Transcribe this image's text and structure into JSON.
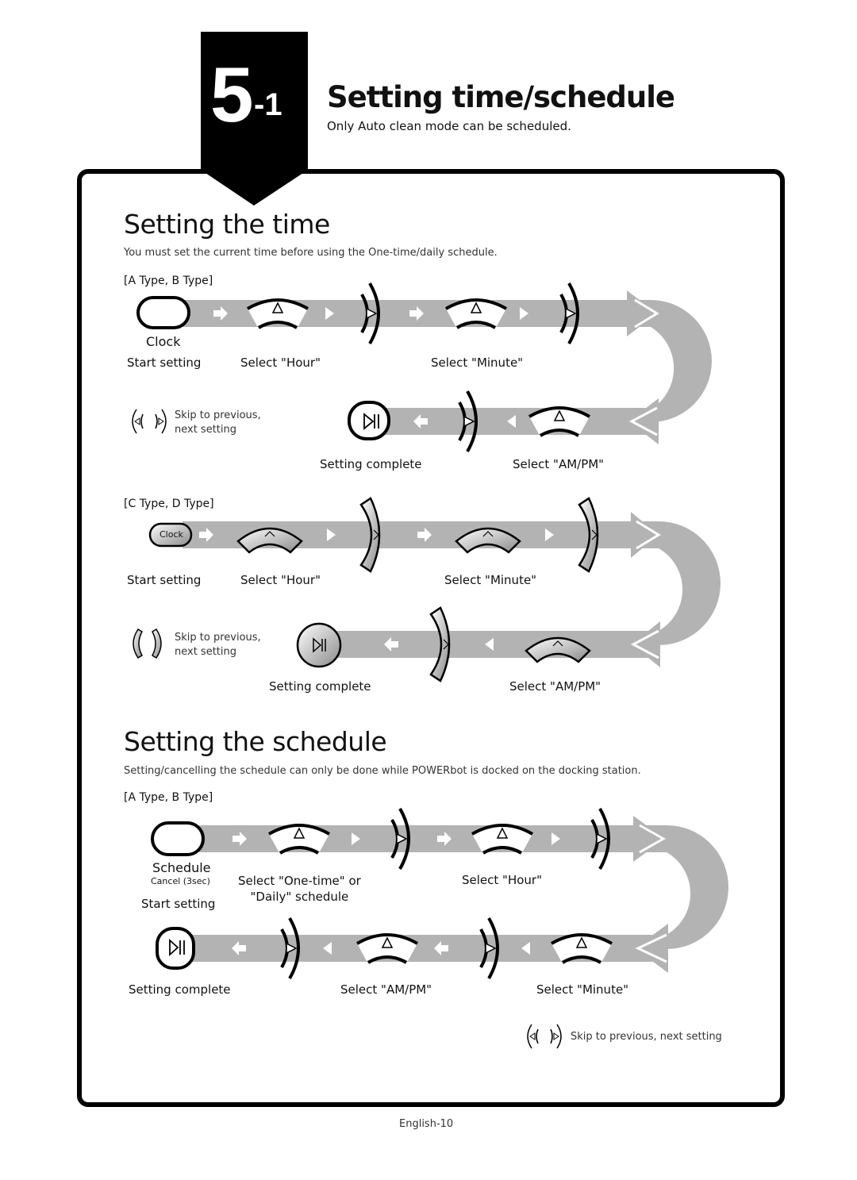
{
  "header": {
    "chapter_number": "5",
    "chapter_sub": "-1",
    "title": "Setting time/schedule",
    "subtitle": "Only Auto clean mode can be scheduled."
  },
  "section_time": {
    "heading": "Setting the time",
    "description": "You must set the current time before using the One-time/daily schedule.",
    "ab_type": {
      "label": "[A Type, B Type]",
      "button_label": "Clock",
      "steps": [
        "Start setting",
        "Select \"Hour\"",
        "Select \"Minute\"",
        "Select \"AM/PM\"",
        "Setting complete"
      ],
      "skip_note": "Skip to previous,\nnext setting"
    },
    "cd_type": {
      "label": "[C Type, D Type]",
      "button_label": "Clock",
      "steps": [
        "Start setting",
        "Select \"Hour\"",
        "Select \"Minute\"",
        "Select \"AM/PM\"",
        "Setting complete"
      ],
      "skip_note": "Skip to previous,\nnext setting"
    }
  },
  "section_schedule": {
    "heading": "Setting the schedule",
    "description": "Setting/cancelling the schedule can only be done while POWERbot is docked on the docking station.",
    "ab_type": {
      "label": "[A Type, B Type]",
      "button_label": "Schedule",
      "button_sublabel": "Cancel (3sec)",
      "steps": [
        "Start setting",
        "Select \"One-time\" or\n\"Daily\" schedule",
        "Select \"Hour\"",
        "Select \"Minute\"",
        "Select \"AM/PM\"",
        "Setting complete"
      ],
      "skip_note": "Skip to previous, next setting"
    }
  },
  "footer": {
    "page_label": "English-10"
  },
  "colors": {
    "band": "#b3b3b3",
    "ink": "#000000"
  }
}
